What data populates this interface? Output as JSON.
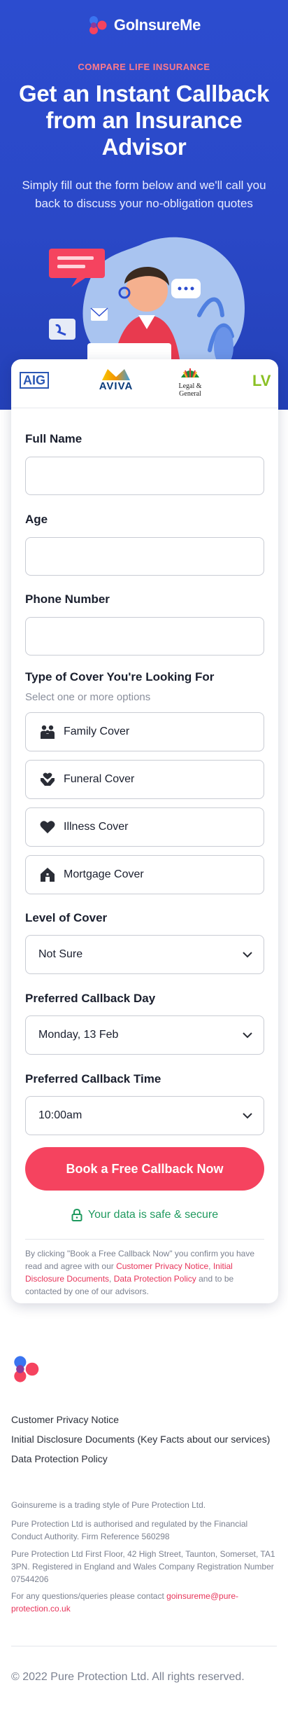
{
  "brand": {
    "name": "GoInsureMe"
  },
  "hero": {
    "eyebrow": "COMPARE LIFE INSURANCE",
    "headline": "Get an Instant Callback from an Insurance Advisor",
    "subline": "Simply fill out the form below and we'll call you back to discuss your no-obligation quotes"
  },
  "insurers": {
    "aig": "AIG",
    "aviva": "AVIVA",
    "legal_general_1": "Legal &",
    "legal_general_2": "General",
    "lv": "LV"
  },
  "form": {
    "full_name_label": "Full Name",
    "age_label": "Age",
    "phone_label": "Phone Number",
    "cover_type_label": "Type of Cover You're Looking For",
    "cover_type_hint": "Select one or more options",
    "cover_options": [
      "Family Cover",
      "Funeral Cover",
      "Illness Cover",
      "Mortgage Cover"
    ],
    "level_label": "Level of Cover",
    "level_value": "Not Sure",
    "day_label": "Preferred Callback Day",
    "day_value": "Monday, 13 Feb",
    "time_label": "Preferred Callback Time",
    "time_value": "10:00am",
    "submit_label": "Book a Free Callback Now",
    "safe_text": "Your data is safe & secure",
    "disclaimer_pre": "By clicking \"Book a Free Callback Now\" you confirm you have read and agree with our ",
    "disclaimer_link1": "Customer Privacy Notice",
    "disclaimer_sep1": ", ",
    "disclaimer_link2": "Initial Disclosure Documents",
    "disclaimer_sep2": ", ",
    "disclaimer_link3": "Data Protection Policy",
    "disclaimer_post": " and to be contacted by one of our advisors."
  },
  "footer": {
    "links": [
      "Customer Privacy Notice",
      "Initial Disclosure Documents (Key Facts about our services)",
      "Data Protection Policy"
    ],
    "trading": "Goinsureme is a trading style of Pure Protection Ltd.",
    "regulated": "Pure Protection Ltd is authorised and regulated by the Financial Conduct Authority. Firm Reference 560298",
    "address": "Pure Protection Ltd First Floor, 42 High Street, Taunton, Somerset, TA1 3PN. Registered in England and Wales Company Registration Number 07544206",
    "contact_pre": "For any questions/queries please contact ",
    "contact_email": "goinsureme@pure-protection.co.uk",
    "copyright": "© 2022 Pure Protection Ltd. All rights reserved."
  },
  "colors": {
    "hero_blue": "#2c4ccf",
    "accent_pink": "#f5435f",
    "safe_green": "#1f9a5f"
  }
}
